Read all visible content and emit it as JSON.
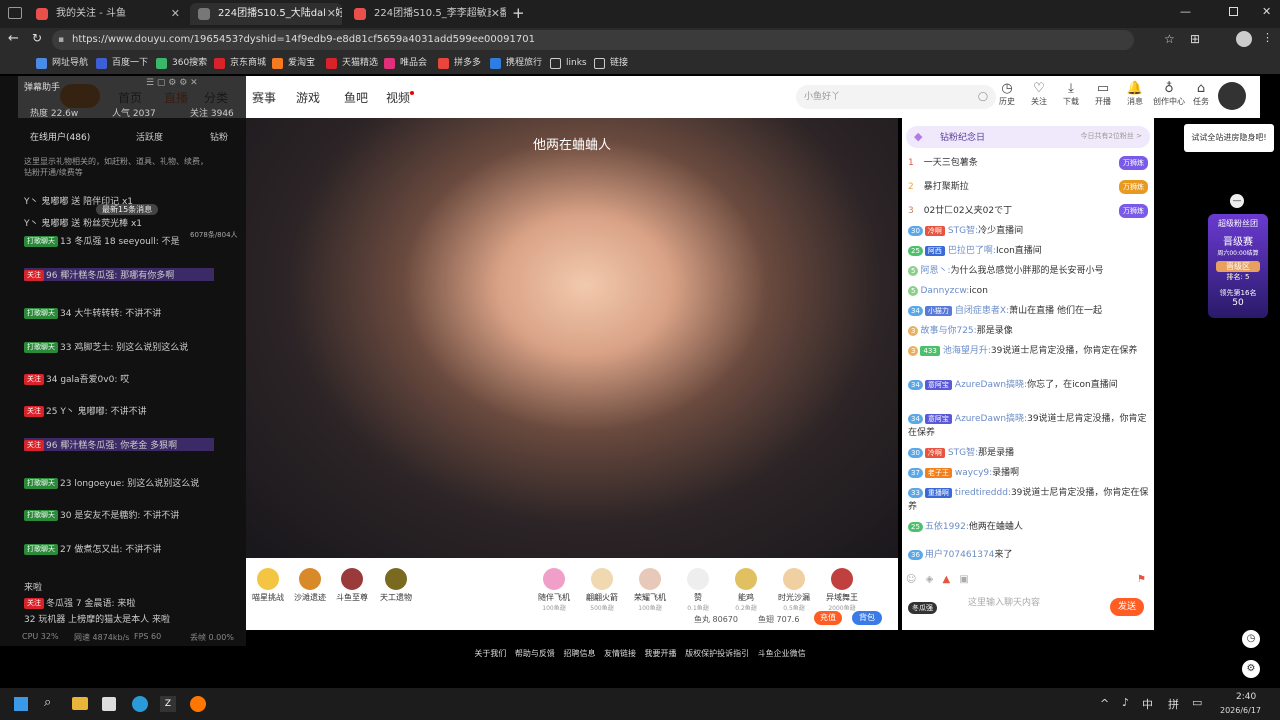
{
  "tabs": [
    {
      "label": "我的关注 - 斗鱼",
      "active": false
    },
    {
      "label": "224团播S10.5_大陆dalin好直播",
      "active": true
    },
    {
      "label": "224团播S10.5_李李超敏直播_李李",
      "active": false
    }
  ],
  "address": "https://www.douyu.com/1965453?dyshid=14f9edb9-e8d81cf5659a4031add599ee00091701",
  "bookmarks": [
    "网址导航",
    "百度一下",
    "360搜索",
    "京东商城",
    "爱淘宝",
    "天猫精选",
    "唯品会",
    "拼多多",
    "携程旅行",
    "links",
    "链接"
  ],
  "header": {
    "nav": [
      "首页",
      "直播",
      "分类",
      "赛事",
      "游戏",
      "鱼吧",
      "视频"
    ],
    "search_placeholder": "小鱼好丫",
    "icons": [
      "历史",
      "关注",
      "下载",
      "开播",
      "消息",
      "创作中心",
      "任务"
    ]
  },
  "helper": {
    "title": "弹幕助手",
    "stats": [
      "热度 22.6w",
      "人气 2037",
      "关注 3946"
    ],
    "tabs": [
      "在线用户(486)",
      "活跃度",
      "钻粉"
    ],
    "notice": "这里显示礼物相关的，如赶粉、道具、礼物、续费，钻粉开通/续费等",
    "unread": "最新15条消息",
    "count": "6078条/804人",
    "lines": [
      {
        "tag": "",
        "text": "Y丶 鬼嘟嘟 送 陪伴印记 x1"
      },
      {
        "tag": "",
        "text": "Y丶 鬼嘟嘟 送 粉丝荧光棒 x1"
      },
      {
        "tag": "打歌聊天",
        "text": "13 冬瓜强  18 seeyoull: 不是"
      },
      {
        "tag": "关注",
        "text": "96 椰汁糕冬瓜强: 那哪有你多啊"
      },
      {
        "tag": "打歌聊天",
        "text": "34 大牛转转转: 不讲不讲"
      },
      {
        "tag": "打歌聊天",
        "text": "33 鸡脚芝士: 别这么说别这么说"
      },
      {
        "tag": "关注",
        "text": "34 gala吾爱0v0: 哎"
      },
      {
        "tag": "关注",
        "text": "25 Y丶 鬼嘟嘟: 不讲不讲"
      },
      {
        "tag": "关注",
        "text": "96 椰汁糕冬瓜强: 你老金 多狠啊"
      },
      {
        "tag": "打歌聊天",
        "text": "23 longoeyue: 别这么说别这么说"
      },
      {
        "tag": "打歌聊天",
        "text": "30 是安友不是糖豹: 不讲不讲"
      },
      {
        "tag": "打歌聊天",
        "text": "27 做煮怎又出: 不讲不讲"
      },
      {
        "tag": "",
        "text": "来啦"
      },
      {
        "tag": "关注",
        "text": "冬瓜强  7 金晨语: 来啦"
      },
      {
        "tag": "",
        "text": "32 玩机器 上榜摩的猫太是本人 来啦"
      }
    ],
    "footer": [
      "CPU 32%",
      "网速 4874kb/s",
      "FPS 60",
      "丢帧 0.00%"
    ]
  },
  "video": {
    "caption": "他两在蛐蛐人"
  },
  "gifts": {
    "left": [
      "喵星挑战",
      "沙滩遗迹",
      "斗鱼至尊",
      "天工遗物"
    ],
    "right": [
      {
        "name": "随伴飞机",
        "price": "100鱼翅"
      },
      {
        "name": "翩翩火箭",
        "price": "500鱼翅"
      },
      {
        "name": "荣耀飞机",
        "price": "100鱼翅"
      },
      {
        "name": "赞",
        "price": "0.1鱼翅"
      },
      {
        "name": "能鸡",
        "price": "0.2鱼翅"
      },
      {
        "name": "时光沙漏",
        "price": "0.5鱼翅"
      },
      {
        "name": "异域舞王",
        "price": "2000鱼翅"
      }
    ],
    "fish_ball": "鱼丸 80670",
    "fish_wing": "鱼翅 707.6",
    "recharge": "充值",
    "backpack": "背包"
  },
  "chat": {
    "banner": "钻粉纪念日",
    "banner_right": "今日共有2位粉丝 >",
    "rank": [
      {
        "n": "1",
        "name": "一天三包薯条",
        "badge": "万狮炼"
      },
      {
        "n": "2",
        "name": "暴打聚斯拉",
        "badge": "万狮炼"
      },
      {
        "n": "3",
        "name": "02廿匚02乂夹02で丁",
        "badge": "万狮炼"
      }
    ],
    "messages": [
      {
        "lv": "30",
        "fb": "冷啊",
        "name": "STG智:",
        "text": "冷少直播间"
      },
      {
        "lv": "25",
        "fb": "阿西",
        "name": "巴拉巴了啊:",
        "text": "Icon直播间"
      },
      {
        "lv": "5",
        "fb": "",
        "name": "阿恩丶:",
        "text": "为什么我总感觉小胖那的是长安哥小号"
      },
      {
        "lv": "5",
        "fb": "",
        "name": "Dannyzcw:",
        "text": "icon"
      },
      {
        "lv": "34",
        "fb": "小猫力",
        "name": "自闭症患者X:",
        "text": "萧山在直播 他们在一起"
      },
      {
        "lv": "3",
        "fb": "",
        "name": "故事与你725:",
        "text": "那是录像"
      },
      {
        "lv": "3",
        "fb": "433",
        "name": "池海望月升:",
        "text": "39说道士尼肯定没播，你肯定在保养"
      },
      {
        "lv": "34",
        "fb": "意阿宝",
        "name": "AzureDawn搞晓:",
        "text": "你忘了，在icon直播间"
      },
      {
        "lv": "34",
        "fb": "意阿宝",
        "name": "AzureDawn搞晓:",
        "text": "39说道士尼肯定没播，你肯定在保养"
      },
      {
        "lv": "30",
        "fb": "冷啊",
        "name": "STG智:",
        "text": "那是录播"
      },
      {
        "lv": "37",
        "fb": "老子王",
        "name": "waycy9:",
        "text": "录播啊"
      },
      {
        "lv": "33",
        "fb": "重播啊",
        "name": "tiredtireddd:",
        "text": "39说道士尼肯定没播，你肯定在保养"
      },
      {
        "lv": "25",
        "fb": "",
        "name": "五依1992:",
        "text": "他两在蛐蛐人"
      },
      {
        "lv": "36",
        "fb": "",
        "name": "用户707461374",
        "text": "来了"
      }
    ],
    "input_placeholder": "这里输入聊天内容",
    "send": "发送",
    "badge": "冬瓜强"
  },
  "side": {
    "tip": "试试全站进房隐身吧!",
    "fan": "超级粉丝团",
    "promo": "晋级赛",
    "promo_time": "周六00:00结算",
    "promo_level": "晋级区",
    "rank": "排名: 5",
    "lead": "领先第16名",
    "lead_value": "50"
  },
  "footer": [
    "关于我们",
    "帮助与反馈",
    "招聘信息",
    "友情链接",
    "我要开播",
    "版权保护投诉指引",
    "斗鱼企业微信"
  ],
  "taskbar": {
    "time": "2:40",
    "date": "2026/6/17",
    "ime": [
      "中",
      "拼"
    ]
  }
}
